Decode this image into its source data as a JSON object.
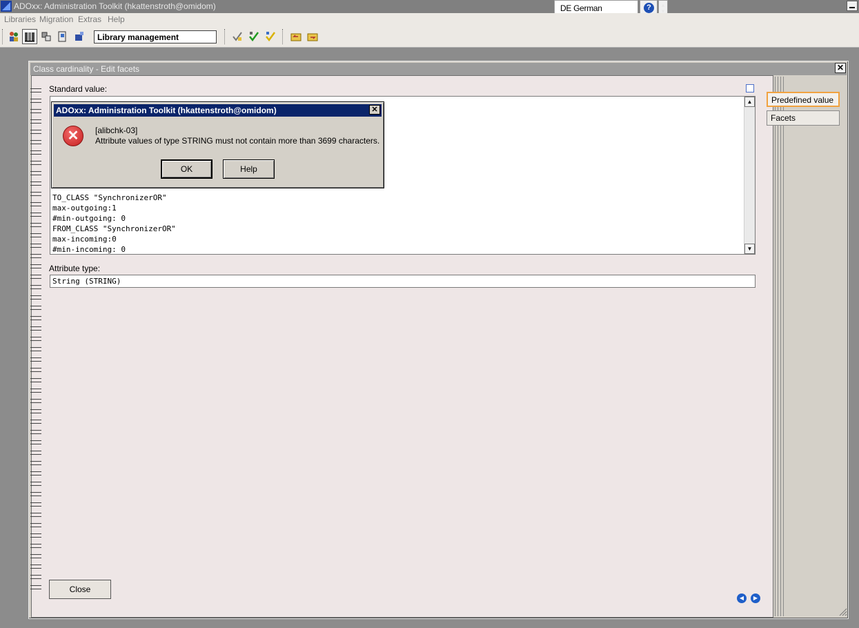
{
  "window": {
    "title": "ADOxx: Administration Toolkit (hkattenstroth@omidom)",
    "language": "DE German (Germany)",
    "help_symbol": "?"
  },
  "menu": {
    "items": [
      "Libraries",
      "Migration",
      "Extras",
      "Help"
    ]
  },
  "toolbar": {
    "library_field": "Library management"
  },
  "child_window": {
    "title": "Class cardinality - Edit facets",
    "standard_value_label": "Standard value:",
    "standard_value_lines": [
      "TO_CLASS \"SynchronizerOR\"",
      "max-outgoing:1",
      "#min-outgoing: 0",
      "FROM_CLASS \"SynchronizerOR\"",
      "max-incoming:0",
      "#min-incoming: 0"
    ],
    "attribute_type_label": "Attribute type:",
    "attribute_type_value": "String (STRING)",
    "tabs": [
      "Predefined value",
      "Facets"
    ],
    "active_tab": "Predefined value",
    "close_button": "Close"
  },
  "error_dialog": {
    "title": "ADOxx: Administration Toolkit (hkattenstroth@omidom)",
    "code": "[alibchk-03]",
    "message": "Attribute values of type STRING must not contain more than 3699 characters.",
    "ok_button": "OK",
    "help_button": "Help",
    "icon": "error-icon"
  },
  "colors": {
    "dialog_title_bg": "#0a246a",
    "active_tab_border": "#f1a240",
    "notebook_bg": "#eee6e6"
  }
}
